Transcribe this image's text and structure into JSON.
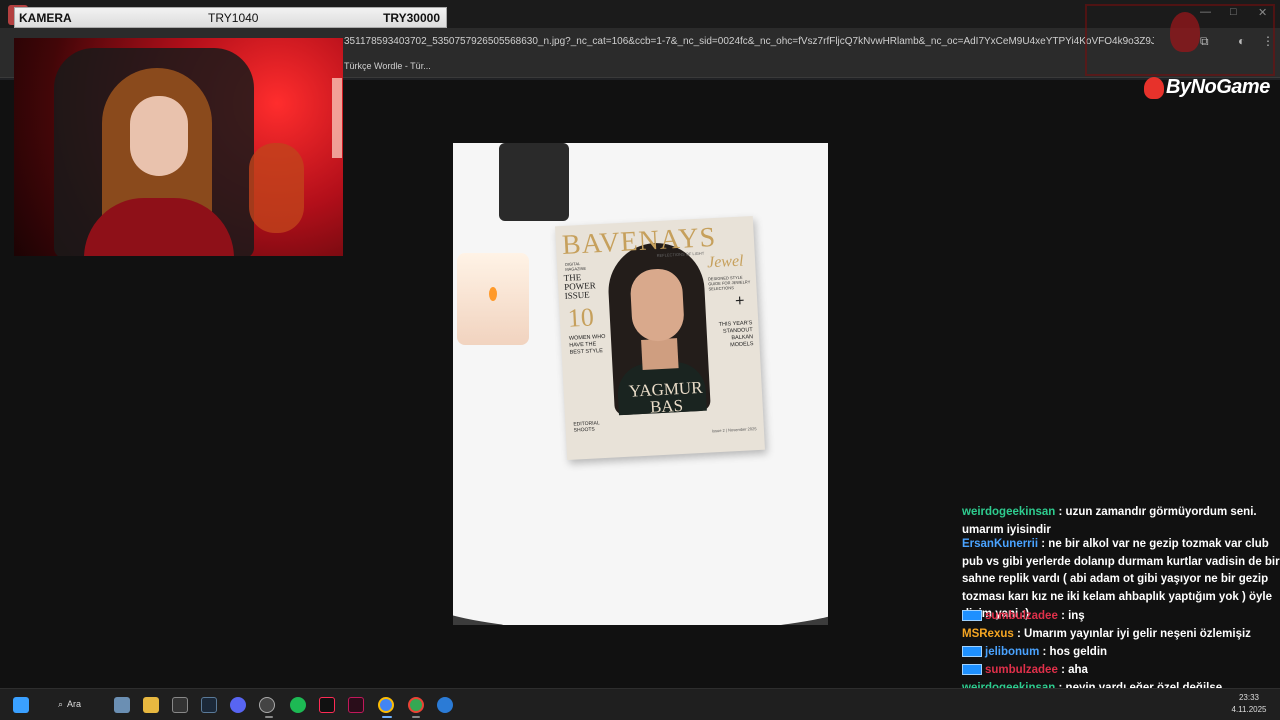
{
  "overlay": {
    "camera_label": "KAMERA",
    "value_1": "TRY1040",
    "value_2": "TRY30000"
  },
  "browser": {
    "url": "351178593403702_5350757926505568630_n.jpg?_nc_cat=106&ccb=1-7&_nc_sid=0024fc&_nc_ohc=fVsz7rfFljcQ7kNvwHRlamb&_nc_oc=AdI7YxCeM9U4xeYTPYi4KoVFO4k9o3Z9Je12fhfDvl4RT1N...",
    "bookmark": "Türkçe Wordle - Tür..."
  },
  "brand": {
    "name": "ByNoGame"
  },
  "magazine": {
    "title": "BAVENAYS",
    "subtitle": "REFLECTIONS OF LIGHT",
    "digital": "DIGITAL MAGAZINE",
    "power": "THE POWER ISSUE",
    "number": "10",
    "women": "WOMEN WHO HAVE THE BEST STYLE",
    "jewel": "Jewel",
    "jewel_sub": "DESIGNED STYLE GUIDE FOR JEWELRY SELECTIONS",
    "plus": "+",
    "year": "THIS YEAR'S STANDOUT BALKAN MODELS",
    "name_1": "YAGMUR",
    "name_2": "BAS",
    "editorial": "EDITORIAL SHOOTS",
    "issue": "Issue 2 | November 2025"
  },
  "chat": [
    {
      "user": "weirdogeekinsan",
      "color": "#2ecc8f",
      "text": ": uzun zamandır görmüyordum seni. umarım iyisindir",
      "badge": false
    },
    {
      "user": "ErsanKunerrii",
      "color": "#4aa3ff",
      "text": ": ne bir alkol var ne gezip tozmak var club pub vs gibi yerlerde dolanıp durmam kurtlar vadisin de bir sahne replik vardı ( abi adam ot gibi yaşıyor ne bir gezip tozması karı kız ne iki kelam ahbaplık yaptığım yok ) öyle diyim yani :)",
      "badge": false
    },
    {
      "user": "sumbulzadee",
      "color": "#e0304a",
      "text": ": inş",
      "badge": true
    },
    {
      "user": "MSRexus",
      "color": "#f5a623",
      "text": ": Umarım yayınlar iyi gelir neşeni özlemişiz",
      "badge": false
    },
    {
      "user": "jelibonum",
      "color": "#4aa3ff",
      "text": ": hos geldin",
      "badge": true
    },
    {
      "user": "sumbulzadee",
      "color": "#e0304a",
      "text": ": aha",
      "badge": true
    },
    {
      "user": "weirdogeekinsan",
      "color": "#2ecc8f",
      "text": ": neyin vardı,eğer özel değilse",
      "badge": false
    },
    {
      "user": "jelibonum",
      "color": "#4aa3ff",
      "text": ": 🐊 🐊 🐊 🐊 🐊 🐊 🐊 🐊",
      "badge": true
    }
  ],
  "taskbar": {
    "search_label": "Ara",
    "time": "23:33",
    "date": "4.11.2025"
  }
}
